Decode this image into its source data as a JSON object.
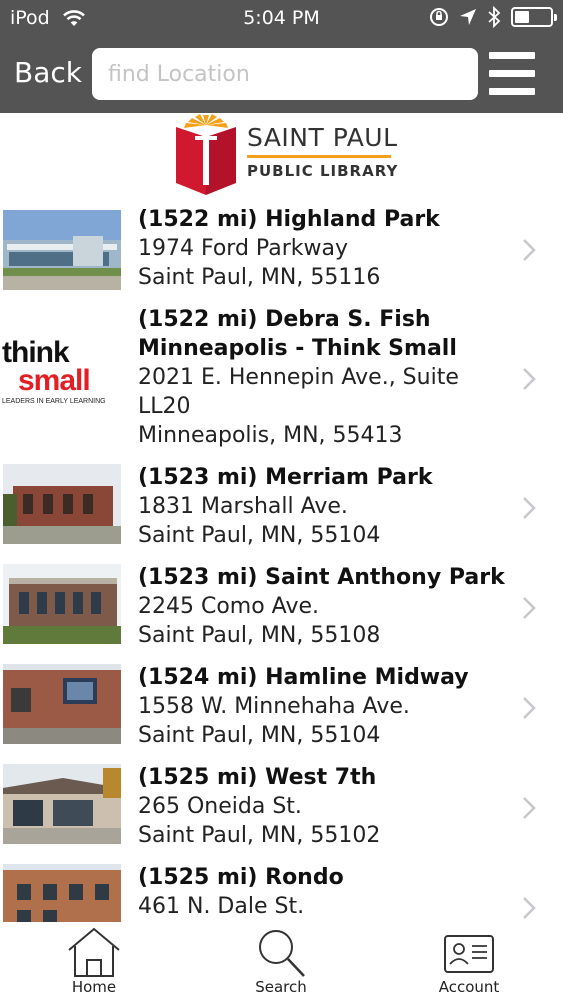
{
  "status_bar": {
    "carrier": "iPod",
    "time": "5:04 PM"
  },
  "nav": {
    "back_label": "Back",
    "search_placeholder": "find Location"
  },
  "logo": {
    "line1": "SAINT PAUL",
    "line2": "PUBLIC LIBRARY"
  },
  "locations": [
    {
      "title": "(1522 mi) Highland Park",
      "address": "1974 Ford Parkway",
      "city": "Saint Paul, MN, 55116"
    },
    {
      "title_line1": "(1522 mi) Debra S. Fish",
      "title_line2": "Minneapolis - Think Small",
      "address_line1": "2021 E. Hennepin Ave., Suite",
      "address_line2": "LL20",
      "city": "Minneapolis, MN, 55413",
      "logo_word1": "think",
      "logo_word2": "small",
      "logo_tagline": "LEADERS IN EARLY LEARNING"
    },
    {
      "title": "(1523 mi) Merriam Park",
      "address": "1831 Marshall Ave.",
      "city": "Saint Paul, MN, 55104"
    },
    {
      "title": "(1523 mi) Saint Anthony Park",
      "address": "2245 Como Ave.",
      "city": "Saint Paul, MN, 55108"
    },
    {
      "title": "(1524 mi) Hamline Midway",
      "address": "1558 W. Minnehaha Ave.",
      "city": "Saint Paul, MN, 55104"
    },
    {
      "title": "(1525 mi) West 7th",
      "address": "265 Oneida St.",
      "city": "Saint Paul, MN, 55102"
    },
    {
      "title": "(1525 mi) Rondo",
      "address": "461 N. Dale St."
    }
  ],
  "tabs": [
    {
      "label": "Home",
      "icon": "home-icon"
    },
    {
      "label": "Search",
      "icon": "search-icon"
    },
    {
      "label": "Account",
      "icon": "account-card-icon"
    }
  ],
  "colors": {
    "bar": "#545454",
    "accent_orange": "#f5a01a",
    "logo_red": "#d0192f",
    "think_small_red": "#e31e24"
  }
}
